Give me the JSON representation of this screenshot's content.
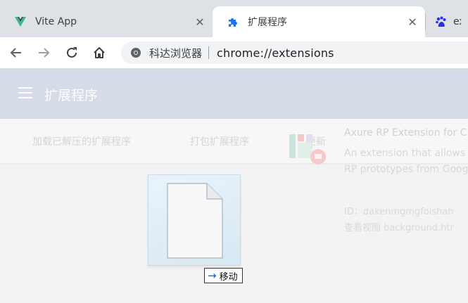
{
  "tabs": [
    {
      "title": "Vite App",
      "icon": "vite-icon",
      "close": "✕"
    },
    {
      "title": "扩展程序",
      "icon": "puzzle-icon",
      "close": "✕"
    },
    {
      "title": "ext",
      "icon": "baidu-icon"
    }
  ],
  "toolbar": {
    "site_name": "科达浏览器",
    "url": "chrome://extensions"
  },
  "page": {
    "title": "扩展程序",
    "buttons": [
      "加载已解压的扩展程序",
      "打包扩展程序",
      "更新"
    ]
  },
  "extension_card": {
    "name": "Axure RP Extension for C",
    "description_lines": [
      "An extension that allows",
      "RP prototypes from Goog"
    ],
    "id": "ID：dakenmgmgfoishah",
    "views": "查看视图 background.htr"
  },
  "drag": {
    "label": "移动"
  },
  "colors": {
    "tabstrip": "#dee1e6",
    "header": "#d6dbe8",
    "vite_green": "#41b883",
    "puzzle_blue": "#1a73e8"
  }
}
